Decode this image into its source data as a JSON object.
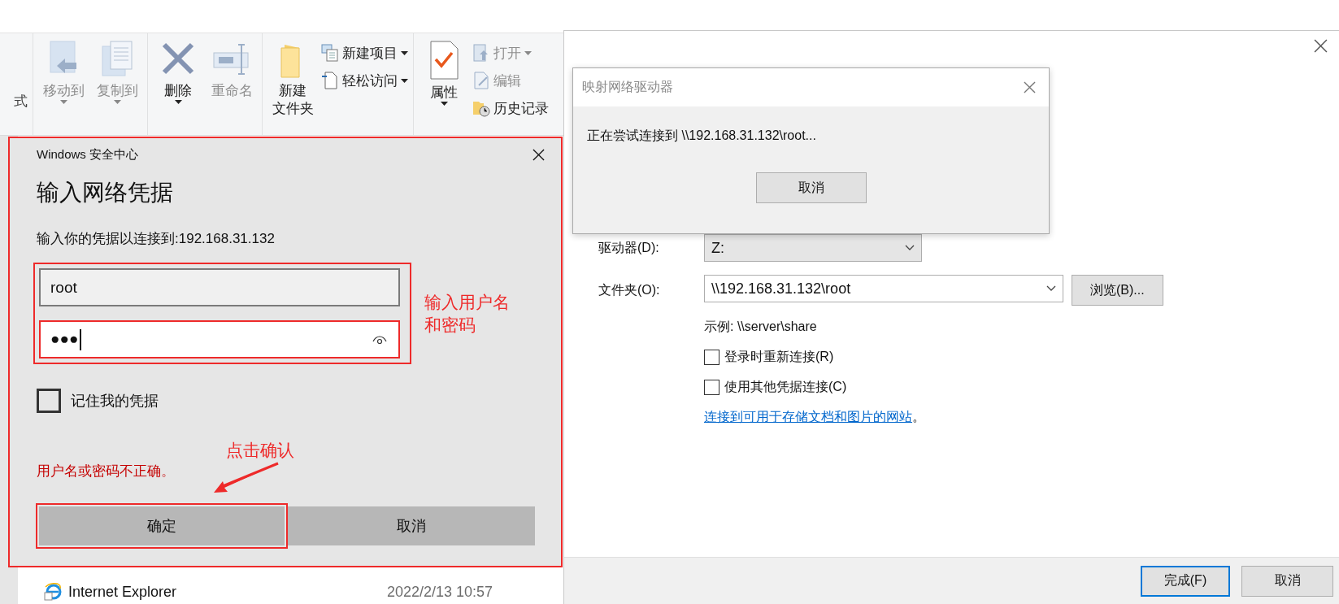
{
  "explorer": {
    "ribbon": {
      "cut_label": "式",
      "groups": [
        {
          "large": [
            {
              "lines": [
                "移动到"
              ],
              "disabled": true,
              "dropdown": true
            },
            {
              "lines": [
                "复制到"
              ],
              "disabled": true,
              "dropdown": true
            }
          ]
        },
        {
          "large": [
            {
              "lines": [
                "删除"
              ],
              "disabled": false,
              "dropdown": true
            },
            {
              "lines": [
                "重命名"
              ],
              "disabled": true,
              "dropdown": false
            }
          ]
        },
        {
          "large": [
            {
              "lines": [
                "新建",
                "文件夹"
              ],
              "disabled": false,
              "dropdown": false
            }
          ],
          "small": [
            {
              "label": "新建项目",
              "disabled": false,
              "dropdown": true
            },
            {
              "label": "轻松访问",
              "disabled": false,
              "dropdown": true
            }
          ]
        },
        {
          "large": [
            {
              "lines": [
                "属性"
              ],
              "disabled": false,
              "dropdown": true
            }
          ],
          "small": [
            {
              "label": "打开",
              "disabled": true,
              "dropdown": true
            },
            {
              "label": "编辑",
              "disabled": true,
              "dropdown": false
            },
            {
              "label": "历史记录",
              "disabled": false,
              "dropdown": false
            }
          ]
        }
      ]
    },
    "files": [
      {
        "name": "Internet Explorer",
        "date": "2022/2/13 10:57"
      }
    ]
  },
  "wizard": {
    "drive_label": "驱动器(D):",
    "drive_value": "Z:",
    "folder_label": "文件夹(O):",
    "folder_value": "\\\\192.168.31.132\\root",
    "browse_button": "浏览(B)...",
    "example": "示例: \\\\server\\share",
    "options": [
      {
        "label": "登录时重新连接(R)",
        "checked": false
      },
      {
        "label": "使用其他凭据连接(C)",
        "checked": false
      }
    ],
    "link": "连接到可用于存储文档和图片的网站",
    "link_tail": "。",
    "buttons": [
      {
        "label": "完成(F)",
        "default": true
      },
      {
        "label": "取消",
        "default": false
      }
    ]
  },
  "progress_dialog": {
    "title": "映射网络驱动器",
    "message": "正在尝试连接到 \\\\192.168.31.132\\root...",
    "button": "取消"
  },
  "credential_dialog": {
    "title": "Windows 安全中心",
    "heading": "输入网络凭据",
    "prompt": "输入你的凭据以连接到:192.168.31.132",
    "username": "root",
    "password": "●●●",
    "remember": {
      "label": "记住我的凭据",
      "checked": false
    },
    "error": "用户名或密码不正确。",
    "buttons": [
      {
        "label": "确定",
        "highlighted": true
      },
      {
        "label": "取消",
        "highlighted": false
      }
    ]
  },
  "annotations": {
    "fields_note": [
      "输入用户名",
      "和密码"
    ],
    "confirm_note": "点击确认"
  }
}
